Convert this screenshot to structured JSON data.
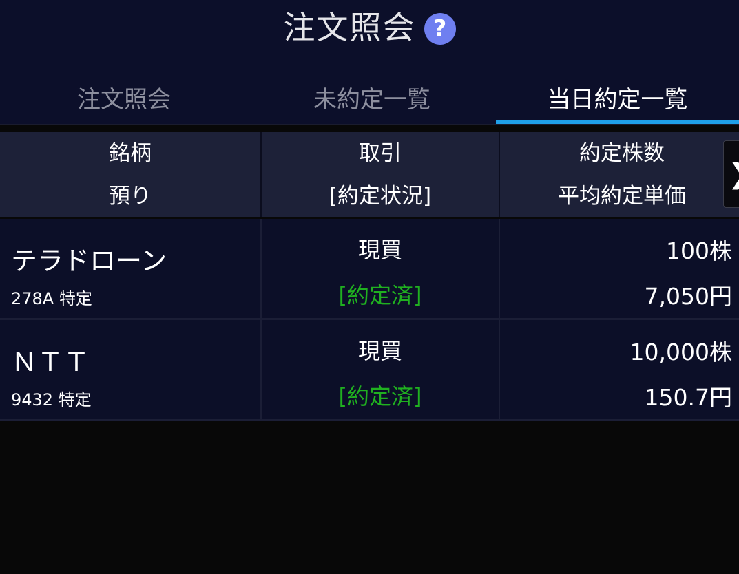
{
  "header": {
    "title": "注文照会",
    "help_icon": "question-circle-icon"
  },
  "tabs": [
    {
      "label": "注文照会",
      "active": false
    },
    {
      "label": "未約定一覧",
      "active": false
    },
    {
      "label": "当日約定一覧",
      "active": true
    }
  ],
  "colors": {
    "accent": "#1fa0e8",
    "status_green": "#20b020",
    "help_icon_bg": "#6f7ff0"
  },
  "table": {
    "columns": [
      {
        "line1": "銘柄",
        "line2": "預り"
      },
      {
        "line1": "取引",
        "line2": "[約定状況]"
      },
      {
        "line1": "約定株数",
        "line2": "平均約定単価"
      }
    ],
    "scroll_glyph": "❯",
    "rows": [
      {
        "name": "テラドローン",
        "code": "278A 特定",
        "trade": "現買",
        "status": "[約定済]",
        "qty": "100株",
        "price": "7,050円"
      },
      {
        "name": "ＮＴＴ",
        "code": "9432 特定",
        "trade": "現買",
        "status": "[約定済]",
        "qty": "10,000株",
        "price": "150.7円"
      }
    ]
  }
}
